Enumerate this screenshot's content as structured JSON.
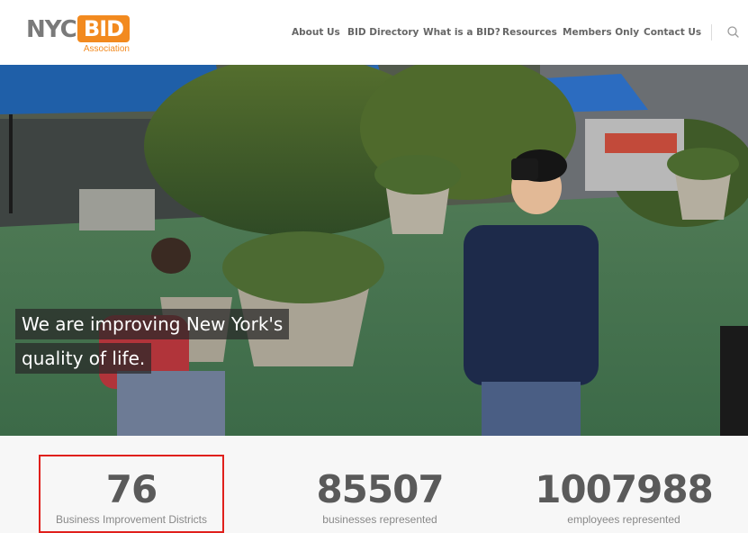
{
  "logo": {
    "nyc": "NYC",
    "bid": "BID",
    "association": "Association"
  },
  "nav": {
    "items": [
      {
        "label": "About Us"
      },
      {
        "label": "BID Directory"
      },
      {
        "label": "What is a BID?"
      },
      {
        "label": "Resources"
      },
      {
        "label": "Members Only"
      },
      {
        "label": "Contact Us"
      }
    ],
    "search_icon": "search-icon"
  },
  "hero": {
    "tagline_line1": "We are improving New York's",
    "tagline_line2": "quality of life."
  },
  "stats": [
    {
      "number": "76",
      "label": "Business Improvement Districts",
      "highlighted": true
    },
    {
      "number": "85507",
      "label": "businesses represented",
      "highlighted": false
    },
    {
      "number": "1007988",
      "label": "employees represented",
      "highlighted": false
    }
  ],
  "colors": {
    "brand_orange": "#f28a1f",
    "logo_gray": "#7a7a7a",
    "highlight_red": "#e0201c",
    "stat_gray": "#5a5a5a"
  }
}
